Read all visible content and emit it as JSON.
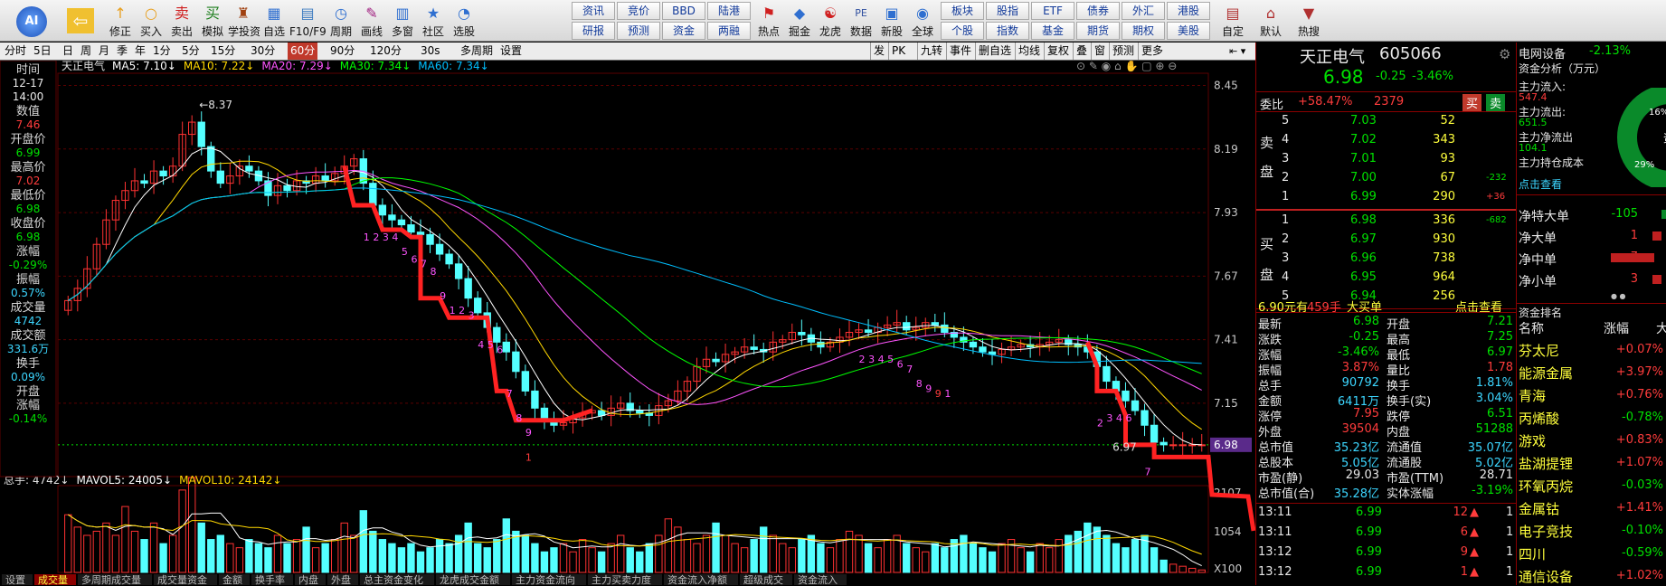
{
  "toolbar": {
    "buttons": [
      {
        "label": "修正",
        "icon": "↑"
      },
      {
        "label": "买入",
        "icon": "○"
      },
      {
        "label": "卖出",
        "icon": "卖"
      },
      {
        "label": "模拟",
        "icon": "买"
      },
      {
        "label": "学投资",
        "icon": "♜"
      },
      {
        "label": "自选",
        "icon": "▦"
      },
      {
        "label": "F10/F9",
        "icon": "▤"
      },
      {
        "label": "周期",
        "icon": "◷"
      },
      {
        "label": "画线",
        "icon": "✎"
      },
      {
        "label": "多窗",
        "icon": "▥"
      },
      {
        "label": "社区",
        "icon": "★"
      },
      {
        "label": "选股",
        "icon": "◔"
      }
    ],
    "grid": [
      [
        "资讯",
        "竞价",
        "BBD",
        "陆港"
      ],
      [
        "研报",
        "预测",
        "资金",
        "两融"
      ]
    ],
    "buttons2": [
      {
        "label": "热点",
        "icon": "⚑"
      },
      {
        "label": "掘金",
        "icon": "◆"
      },
      {
        "label": "龙虎",
        "icon": "☯"
      },
      {
        "label": "数据",
        "icon": "PE"
      },
      {
        "label": "新股",
        "icon": "▣"
      },
      {
        "label": "全球",
        "icon": "◉"
      }
    ],
    "grid2": [
      [
        "板块",
        "股指",
        "ETF",
        "债券",
        "外汇",
        "港股"
      ],
      [
        "个股",
        "指数",
        "基金",
        "期货",
        "期权",
        "美股"
      ]
    ],
    "buttons3": [
      {
        "label": "自定",
        "icon": "▤"
      },
      {
        "label": "默认",
        "icon": "⌂"
      },
      {
        "label": "热搜",
        "icon": "▼"
      }
    ]
  },
  "periods": [
    "分时",
    "5日",
    "日",
    "周",
    "月",
    "季",
    "年",
    "1分",
    "5分",
    "15分",
    "30分",
    "60分",
    "90分",
    "120分",
    "30s",
    "多周期",
    "设置"
  ],
  "period_selected": "60分",
  "chart_tools": [
    "发",
    "PK",
    "九转",
    "事件",
    "删自选",
    "均线",
    "复权",
    "叠",
    "窗",
    "预测",
    "更多"
  ],
  "legend": {
    "prefix": "天正电气",
    "ma5": "MA5: 7.10↓",
    "ma10": "MA10: 7.22↓",
    "ma20": "MA20: 7.29↓",
    "ma30": "MA30: 7.34↓",
    "ma60": "MA60: 7.34↓"
  },
  "vol_legend": {
    "total": "总手: 4742↓",
    "mavol5": "MAVOL5: 24005↓",
    "mavol10": "MAVOL10: 24142↓"
  },
  "info_col": [
    {
      "label": "时间",
      "value": "12-17",
      "cls": "wh"
    },
    {
      "label": "",
      "value": "14:00",
      "cls": "wh"
    },
    {
      "label": "数值",
      "value": "7.46",
      "cls": "up"
    },
    {
      "label": "开盘价",
      "value": "6.99",
      "cls": "dn"
    },
    {
      "label": "最高价",
      "value": "7.02",
      "cls": "up"
    },
    {
      "label": "最低价",
      "value": "6.98",
      "cls": "dn"
    },
    {
      "label": "收盘价",
      "value": "6.98",
      "cls": "dn"
    },
    {
      "label": "涨幅",
      "value": "-0.29%",
      "cls": "dn"
    },
    {
      "label": "振幅",
      "value": "0.57%",
      "cls": "cy"
    },
    {
      "label": "成交量",
      "value": "4742",
      "cls": "cy"
    },
    {
      "label": "成交额",
      "value": "331.6万",
      "cls": "cy"
    },
    {
      "label": "换手",
      "value": "0.09%",
      "cls": "cy"
    },
    {
      "label": "开盘",
      "value": "",
      "cls": "wh"
    },
    {
      "label": "涨幅",
      "value": "-0.14%",
      "cls": "dn"
    }
  ],
  "price_axis": [
    "8.45",
    "8.19",
    "7.93",
    "7.67",
    "7.41",
    "7.15",
    "6.98",
    "2107",
    "1054",
    "X100"
  ],
  "annotations": {
    "high": "8.37",
    "low": "6.97"
  },
  "nine_labels": [
    "1",
    "2",
    "3",
    "4",
    "5",
    "6",
    "7",
    "8",
    "9",
    "1",
    "2",
    "3",
    "4",
    "5",
    "6",
    "7",
    "8",
    "9",
    "1",
    "2",
    "3",
    "4",
    "5",
    "6",
    "7",
    "8",
    "9",
    "9",
    "1",
    "2",
    "3",
    "4",
    "6",
    "7"
  ],
  "bottom_tabs": [
    "设置",
    "成交量",
    "多周期成交量",
    "成交量资金",
    "金额",
    "换手率",
    "内盘",
    "外盘",
    "总主资金变化",
    "龙虎成交金额",
    "主力资金流向",
    "主力买卖力度",
    "资金流入净额",
    "超级成交",
    "资金流入"
  ],
  "stock": {
    "name": "天正电气",
    "code": "605066",
    "price": "6.98",
    "change": "-0.25",
    "pct": "-3.46%"
  },
  "weibi": {
    "label": "委比",
    "value": "+58.47%",
    "count": "2379",
    "buy": "买",
    "sell": "卖"
  },
  "asks": [
    {
      "lvl": "5",
      "price": "7.03",
      "vol": "52",
      "chg": ""
    },
    {
      "lvl": "4",
      "price": "7.02",
      "vol": "343",
      "chg": ""
    },
    {
      "lvl": "3",
      "price": "7.01",
      "vol": "93",
      "chg": ""
    },
    {
      "lvl": "2",
      "price": "7.00",
      "vol": "67",
      "chg": "-232"
    },
    {
      "lvl": "1",
      "price": "6.99",
      "vol": "290",
      "chg": "+36"
    }
  ],
  "bids": [
    {
      "lvl": "1",
      "price": "6.98",
      "vol": "336",
      "chg": "-682"
    },
    {
      "lvl": "2",
      "price": "6.97",
      "vol": "930",
      "chg": ""
    },
    {
      "lvl": "3",
      "price": "6.96",
      "vol": "738",
      "chg": ""
    },
    {
      "lvl": "4",
      "price": "6.95",
      "vol": "964",
      "chg": ""
    },
    {
      "lvl": "5",
      "price": "6.94",
      "vol": "256",
      "chg": ""
    }
  ],
  "side_labels": {
    "sell": [
      "卖",
      "盘"
    ],
    "buy": [
      "买",
      "盘"
    ]
  },
  "big_order": {
    "price": "6.90元有",
    "vol": "459手",
    "label": "大买单",
    "link": "点击查看"
  },
  "stats": [
    [
      "最新",
      "6.98",
      "dn",
      "开盘",
      "7.21",
      "dn"
    ],
    [
      "涨跌",
      "-0.25",
      "dn",
      "最高",
      "7.25",
      "dn"
    ],
    [
      "涨幅",
      "-3.46%",
      "dn",
      "最低",
      "6.97",
      "dn"
    ],
    [
      "振幅",
      "3.87%",
      "up",
      "量比",
      "1.78",
      "up"
    ],
    [
      "总手",
      "90792",
      "cy",
      "换手",
      "1.81%",
      "cy"
    ],
    [
      "金额",
      "6411万",
      "cy",
      "换手(实)",
      "3.04%",
      "cy"
    ],
    [
      "涨停",
      "7.95",
      "up",
      "跌停",
      "6.51",
      "dn"
    ],
    [
      "外盘",
      "39504",
      "up",
      "内盘",
      "51288",
      "dn"
    ],
    [
      "总市值",
      "35.23亿",
      "cy",
      "流通值",
      "35.07亿",
      "cy"
    ],
    [
      "总股本",
      "5.05亿",
      "cy",
      "流通股",
      "5.02亿",
      "cy"
    ],
    [
      "市盈(静)",
      "29.03",
      "wh",
      "市盈(TTM)",
      "28.71",
      "wh"
    ],
    [
      "总市值(合)",
      "35.28亿",
      "cy",
      "实体涨幅",
      "-3.19%",
      "dn"
    ]
  ],
  "ticks": [
    {
      "time": "13:11",
      "price": "6.99",
      "vol": "12",
      "n": "1"
    },
    {
      "time": "13:11",
      "price": "6.99",
      "vol": "6",
      "n": "1"
    },
    {
      "time": "13:12",
      "price": "6.99",
      "vol": "9",
      "n": "1"
    },
    {
      "time": "13:12",
      "price": "6.99",
      "vol": "1",
      "n": "1"
    }
  ],
  "sector": {
    "name": "电网设备",
    "pct": "-2.13%"
  },
  "fund": {
    "title": "资金分析（万元）",
    "rows": [
      [
        "主力流入:",
        "547.4"
      ],
      [
        "主力流出:",
        "651.5"
      ],
      [
        "主力净流出",
        "104.1"
      ],
      [
        "主力持仓成本",
        ""
      ]
    ],
    "link": "点击查看",
    "pie": {
      "a": "16%",
      "b": "29%",
      "center": "资"
    }
  },
  "net": [
    {
      "label": "净特大单",
      "value": "-105"
    },
    {
      "label": "净大单",
      "value": "1"
    },
    {
      "label": "净中单",
      "value": "7"
    },
    {
      "label": "净小单",
      "value": "3"
    }
  ],
  "rank": {
    "title": "资金排名",
    "col1": "名称",
    "col2": "涨幅",
    "col3": "大",
    "rows": [
      [
        "芬太尼",
        "+0.07%",
        "up"
      ],
      [
        "能源金属",
        "+3.97%",
        "up"
      ],
      [
        "青海",
        "+0.76%",
        "up"
      ],
      [
        "丙烯酸",
        "-0.78%",
        "dn"
      ],
      [
        "游戏",
        "+0.83%",
        "up"
      ],
      [
        "盐湖提锂",
        "+1.07%",
        "up"
      ],
      [
        "环氧丙烷",
        "-0.03%",
        "dn"
      ],
      [
        "金属钴",
        "+1.41%",
        "up"
      ],
      [
        "电子竞技",
        "-0.10%",
        "dn"
      ],
      [
        "四川",
        "-0.59%",
        "dn"
      ],
      [
        "通信设备",
        "+1.02%",
        "up"
      ]
    ]
  },
  "chart_data": {
    "type": "candlestick",
    "title": "天正电气",
    "ylim": [
      6.85,
      8.5
    ],
    "x": [
      1,
      2,
      3,
      4,
      5,
      6,
      7,
      8,
      9,
      10,
      11,
      12,
      13,
      14,
      15,
      16,
      17,
      18,
      19,
      20,
      21,
      22,
      23,
      24,
      25,
      26,
      27,
      28,
      29,
      30,
      31,
      32,
      33,
      34,
      35,
      36,
      37,
      38,
      39,
      40,
      41,
      42,
      43,
      44,
      45,
      46,
      47,
      48,
      49,
      50,
      51,
      52,
      53,
      54,
      55,
      56,
      57,
      58,
      59,
      60,
      61,
      62,
      63,
      64,
      65,
      66,
      67,
      68,
      69,
      70,
      71,
      72,
      73,
      74,
      75,
      76,
      77,
      78,
      79,
      80,
      81,
      82,
      83,
      84,
      85,
      86,
      87,
      88,
      89,
      90,
      91,
      92,
      93,
      94,
      95,
      96,
      97,
      98,
      99,
      100,
      101,
      102,
      103,
      104,
      105,
      106,
      107,
      108,
      109,
      110,
      111,
      112,
      113,
      114,
      115,
      116,
      117,
      118,
      119,
      120
    ],
    "close": [
      7.57,
      7.62,
      7.7,
      7.8,
      7.9,
      7.98,
      8.02,
      8.06,
      8.05,
      8.1,
      8.08,
      8.12,
      8.25,
      8.3,
      8.2,
      8.1,
      8.05,
      8.08,
      8.12,
      8.1,
      8.06,
      8.0,
      8.04,
      8.02,
      8.06,
      8.05,
      8.08,
      8.06,
      8.09,
      8.12,
      8.15,
      8.05,
      7.96,
      7.92,
      7.9,
      7.88,
      7.85,
      7.84,
      7.8,
      7.76,
      7.72,
      7.66,
      7.58,
      7.52,
      7.46,
      7.4,
      7.36,
      7.28,
      7.2,
      7.13,
      7.08,
      7.06,
      7.07,
      7.09,
      7.11,
      7.12,
      7.1,
      7.13,
      7.15,
      7.12,
      7.11,
      7.1,
      7.14,
      7.16,
      7.2,
      7.24,
      7.3,
      7.33,
      7.32,
      7.35,
      7.36,
      7.38,
      7.37,
      7.36,
      7.4,
      7.41,
      7.44,
      7.43,
      7.4,
      7.38,
      7.4,
      7.42,
      7.44,
      7.45,
      7.44,
      7.46,
      7.47,
      7.48,
      7.45,
      7.46,
      7.48,
      7.47,
      7.44,
      7.42,
      7.4,
      7.38,
      7.36,
      7.35,
      7.37,
      7.38,
      7.39,
      7.38,
      7.39,
      7.4,
      7.41,
      7.39,
      7.38,
      7.36,
      7.3,
      7.24,
      7.2,
      7.16,
      7.12,
      7.06,
      6.99,
      6.98,
      6.98,
      6.98,
      6.98,
      6.98
    ],
    "volume": [
      1400,
      1100,
      900,
      1000,
      1200,
      900,
      1600,
      1000,
      800,
      1200,
      700,
      900,
      2000,
      2300,
      1200,
      800,
      900,
      700,
      600,
      800,
      700,
      600,
      900,
      700,
      800,
      1100,
      600,
      700,
      800,
      1200,
      900,
      1500,
      1000,
      800,
      700,
      600,
      700,
      500,
      600,
      800,
      700,
      900,
      1200,
      700,
      600,
      800,
      1300,
      1000,
      900,
      700,
      500,
      600,
      700,
      500,
      800,
      600,
      500,
      700,
      900,
      600,
      500,
      700,
      900,
      1300,
      1100,
      800,
      700,
      900,
      1200,
      900,
      700,
      600,
      800,
      1100,
      900,
      700,
      600,
      800,
      900,
      700,
      600,
      800,
      1000,
      900,
      700,
      600,
      800,
      900,
      700,
      600,
      500,
      700,
      600,
      800,
      900,
      700,
      600,
      500,
      700,
      800,
      600,
      500,
      700,
      600,
      800,
      900,
      1000,
      1200,
      1100,
      900,
      700,
      600,
      800,
      900,
      600,
      300,
      200,
      150,
      100,
      60
    ],
    "series": [
      {
        "name": "MA5",
        "color": "#ffffff"
      },
      {
        "name": "MA10",
        "color": "#ffd700"
      },
      {
        "name": "MA20",
        "color": "#ff55ff"
      },
      {
        "name": "MA30",
        "color": "#00ff00"
      },
      {
        "name": "MA60",
        "color": "#00bfff"
      }
    ],
    "volume_series": [
      {
        "name": "MAVOL5"
      },
      {
        "name": "MAVOL10"
      }
    ],
    "vol_ylim": [
      0,
      2107
    ],
    "colors": {
      "up": "#ff3232",
      "down": "#54ffff",
      "grid": "#5a0000",
      "trend": "#ff2222"
    }
  }
}
